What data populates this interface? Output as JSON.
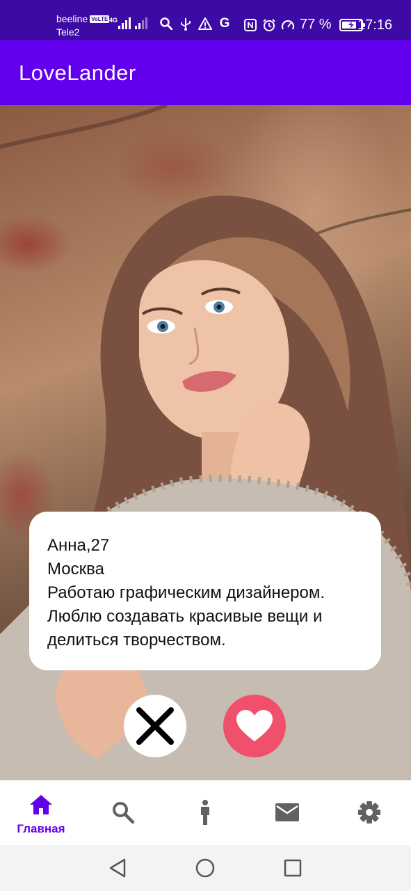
{
  "status_bar": {
    "carrier_1": "beeline",
    "volte": "VoLTE",
    "network_type": "4G",
    "carrier_2": "Tele2",
    "battery_text": "77 %",
    "battery_level": 0.77,
    "time": "17:16",
    "icons": [
      "search-icon",
      "usb-icon",
      "warning-icon",
      "google-icon",
      "nfc-icon",
      "alarm-icon",
      "speedometer-icon",
      "battery-icon"
    ]
  },
  "app_bar": {
    "title": "LoveLander"
  },
  "profile": {
    "name_age": "Анна,27",
    "city": "Москва",
    "bio_line_1": "Работаю графическим дизайнером.",
    "bio_line_2": "Люблю создавать красивые вещи и",
    "bio_line_3": "делиться творчеством."
  },
  "actions": {
    "dislike_icon": "close-icon",
    "like_icon": "heart-icon",
    "like_color": "#f0506b"
  },
  "bottom_nav": {
    "items": [
      {
        "icon": "home-icon",
        "label": "Главная",
        "active": true
      },
      {
        "icon": "search-icon",
        "label": ""
      },
      {
        "icon": "person-icon",
        "label": ""
      },
      {
        "icon": "mail-icon",
        "label": ""
      },
      {
        "icon": "settings-icon",
        "label": ""
      }
    ],
    "active_color": "#6200ee",
    "inactive_color": "#616161"
  },
  "colors": {
    "status_bar": "#3d0aa6",
    "app_bar": "#6200ee"
  }
}
